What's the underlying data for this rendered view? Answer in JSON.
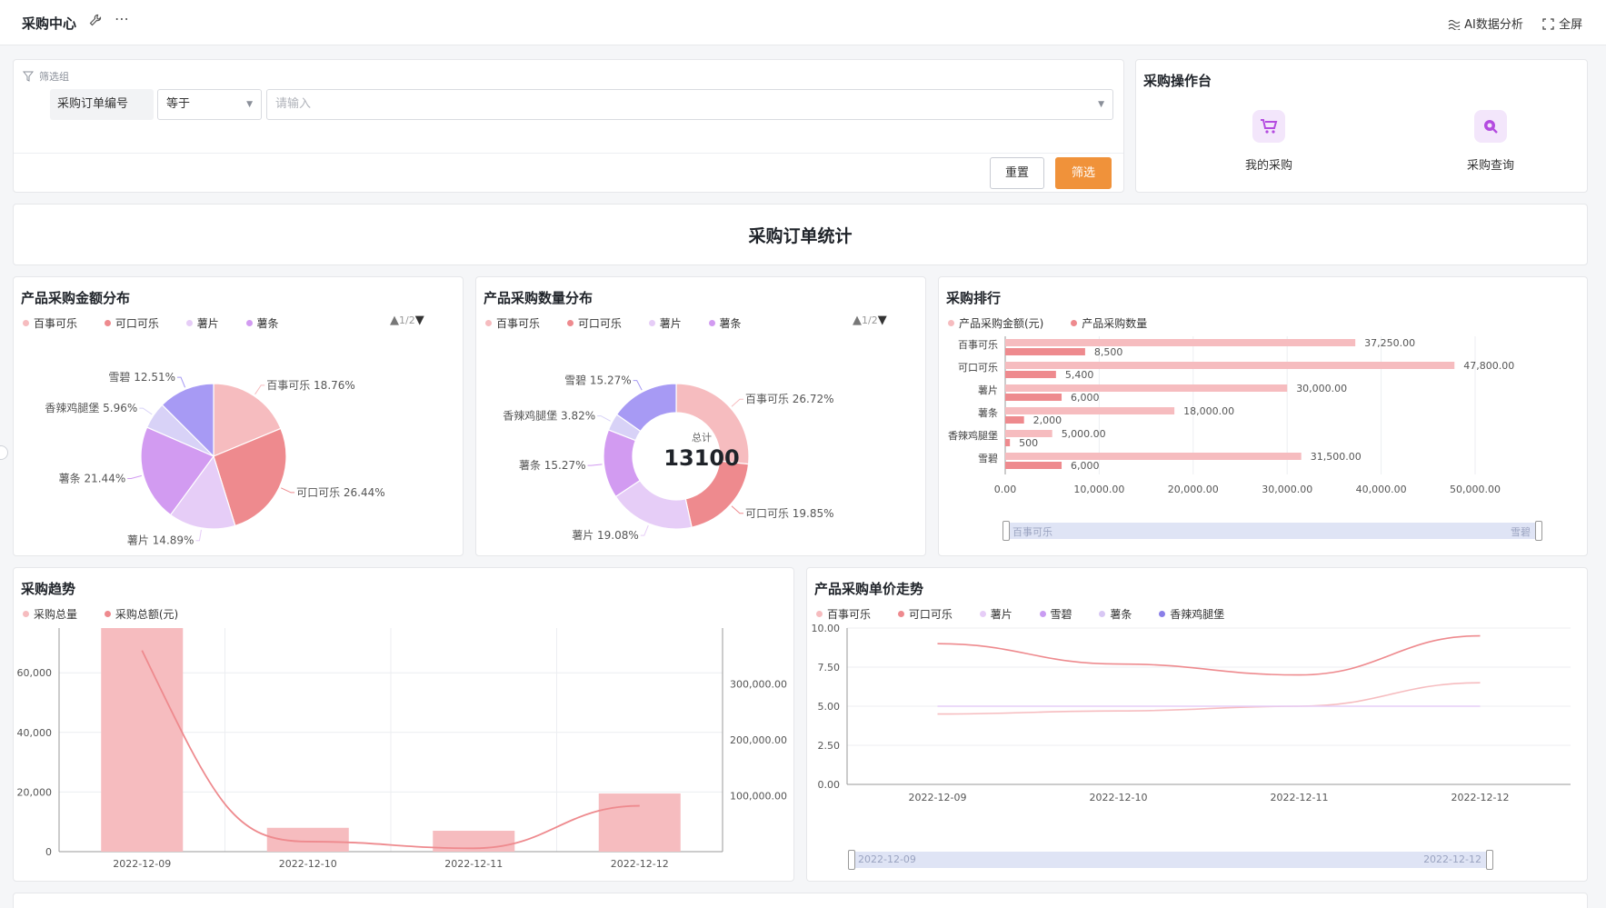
{
  "header": {
    "title": "采购中心",
    "ai_label": "AI数据分析",
    "fullscreen_label": "全屏"
  },
  "filter": {
    "group_label": "筛选组",
    "field_label": "采购订单编号",
    "operator": "等于",
    "value_placeholder": "请输入",
    "reset_label": "重置",
    "submit_label": "筛选"
  },
  "operations": {
    "title": "采购操作台",
    "items": [
      {
        "label": "我的采购",
        "icon": "cart-icon"
      },
      {
        "label": "采购查询",
        "icon": "search-icon"
      }
    ]
  },
  "dashboard_title": "采购订单统计",
  "colors": {
    "baishi": "#f6bcbf",
    "kekou": "#ee8a8e",
    "shupian": "#e6cdf7",
    "xuebi": "#c99cf2",
    "shutiao": "#d8c7f4",
    "xianglajituibao": "#a798f2",
    "accent": "#f0923a"
  },
  "charts": {
    "amount_pie": {
      "title": "产品采购金额分布",
      "pager": "1/2",
      "legend": [
        "百事可乐",
        "可口可乐",
        "薯片",
        "薯条"
      ]
    },
    "qty_donut": {
      "title": "产品采购数量分布",
      "pager": "1/2",
      "legend": [
        "百事可乐",
        "可口可乐",
        "薯片",
        "薯条"
      ],
      "center_label": "总计",
      "center_value": "13100"
    },
    "ranking": {
      "title": "采购排行",
      "legend": [
        "产品采购金额(元)",
        "产品采购数量"
      ],
      "zoom_start": "百事可乐",
      "zoom_end": "雪碧"
    },
    "trend": {
      "title": "采购趋势",
      "legend": [
        "采购总量",
        "采购总额(元)"
      ]
    },
    "unit_price": {
      "title": "产品采购单价走势",
      "legend": [
        "百事可乐",
        "可口可乐",
        "薯片",
        "雪碧",
        "薯条",
        "香辣鸡腿堡"
      ],
      "zoom_start": "2022-12-09",
      "zoom_end": "2022-12-12"
    }
  },
  "chart_data": [
    {
      "type": "pie",
      "title": "产品采购金额分布",
      "slices": [
        {
          "name": "百事可乐",
          "percent": 18.76,
          "label": "百事可乐 18.76%",
          "color": "#f6bcbf"
        },
        {
          "name": "可口可乐",
          "percent": 26.44,
          "label": "可口可乐 26.44%",
          "color": "#ee8a8e"
        },
        {
          "name": "薯片",
          "percent": 14.89,
          "label": "薯片 14.89%",
          "color": "#e6cdf7"
        },
        {
          "name": "薯条",
          "percent": 21.44,
          "label": "薯条 21.44%",
          "color": "#d29bf1"
        },
        {
          "name": "香辣鸡腿堡",
          "percent": 5.96,
          "label": "香辣鸡腿堡 5.96%",
          "color": "#d8d2f7"
        },
        {
          "name": "雪碧",
          "percent": 12.51,
          "label": "雪碧 12.51%",
          "color": "#a79af4"
        }
      ]
    },
    {
      "type": "pie",
      "title": "产品采购数量分布",
      "slices": [
        {
          "name": "百事可乐",
          "percent": 26.72,
          "label": "百事可乐 26.72%",
          "color": "#f6bcbf"
        },
        {
          "name": "可口可乐",
          "percent": 19.85,
          "label": "可口可乐 19.85%",
          "color": "#ee8a8e"
        },
        {
          "name": "薯片",
          "percent": 19.08,
          "label": "薯片 19.08%",
          "color": "#e6cdf7"
        },
        {
          "name": "薯条",
          "percent": 15.27,
          "label": "薯条 15.27%",
          "color": "#d29bf1"
        },
        {
          "name": "香辣鸡腿堡",
          "percent": 3.82,
          "label": "香辣鸡腿堡 3.82%",
          "color": "#d8d2f7"
        },
        {
          "name": "雪碧",
          "percent": 15.27,
          "label": "雪碧 15.27%",
          "color": "#a79af4"
        }
      ]
    },
    {
      "type": "bar",
      "title": "采购排行",
      "orientation": "horizontal",
      "categories": [
        "百事可乐",
        "可口可乐",
        "薯片",
        "薯条",
        "香辣鸡腿堡",
        "雪碧"
      ],
      "series": [
        {
          "name": "产品采购金额(元)",
          "values": [
            37250,
            47800,
            30000,
            18000,
            5000,
            31500
          ],
          "labels": [
            "37,250.00",
            "47,800.00",
            "30,000.00",
            "18,000.00",
            "5,000.00",
            "31,500.00"
          ],
          "color": "#f6bcbf"
        },
        {
          "name": "产品采购数量",
          "values": [
            8500,
            5400,
            6000,
            2000,
            500,
            6000
          ],
          "labels": [
            "8,500",
            "5,400",
            "6,000",
            "2,000",
            "500",
            "6,000"
          ],
          "color": "#ee8a8e"
        }
      ],
      "xlim": [
        0,
        50000
      ],
      "xticks": [
        "0.00",
        "10,000.00",
        "20,000.00",
        "30,000.00",
        "40,000.00",
        "50,000.00"
      ]
    },
    {
      "type": "bar",
      "title": "采购趋势",
      "categories": [
        "2022-12-09",
        "2022-12-10",
        "2022-12-11",
        "2022-12-12"
      ],
      "series": [
        {
          "name": "采购总量",
          "type": "bar",
          "axis": "left",
          "values": [
            75000,
            8000,
            7000,
            19500
          ],
          "color": "#f6bcbf"
        },
        {
          "name": "采购总额(元)",
          "type": "line",
          "axis": "right",
          "values": [
            360000,
            18000,
            6000,
            82000
          ],
          "color": "#ee8a8e"
        }
      ],
      "ylim_left": [
        0,
        75000
      ],
      "yticks_left": [
        "0",
        "20,000",
        "40,000",
        "60,000"
      ],
      "ylim_right": [
        0,
        400000
      ],
      "yticks_right": [
        "100,000.00",
        "200,000.00",
        "300,000.00"
      ]
    },
    {
      "type": "line",
      "title": "产品采购单价走势",
      "x": [
        "2022-12-09",
        "2022-12-10",
        "2022-12-11",
        "2022-12-12"
      ],
      "series": [
        {
          "name": "百事可乐",
          "values": [
            4.5,
            4.7,
            5.0,
            6.5
          ],
          "color": "#f6bcbf"
        },
        {
          "name": "可口可乐",
          "values": [
            9.0,
            7.7,
            7.0,
            9.5
          ],
          "color": "#ee8a8e"
        },
        {
          "name": "薯片",
          "values": [
            5.0,
            5.0,
            5.0,
            5.0
          ],
          "color": "#e6cdf7"
        }
      ],
      "ylim": [
        0,
        10
      ],
      "yticks": [
        "0.00",
        "2.50",
        "5.00",
        "7.50",
        "10.00"
      ]
    }
  ]
}
